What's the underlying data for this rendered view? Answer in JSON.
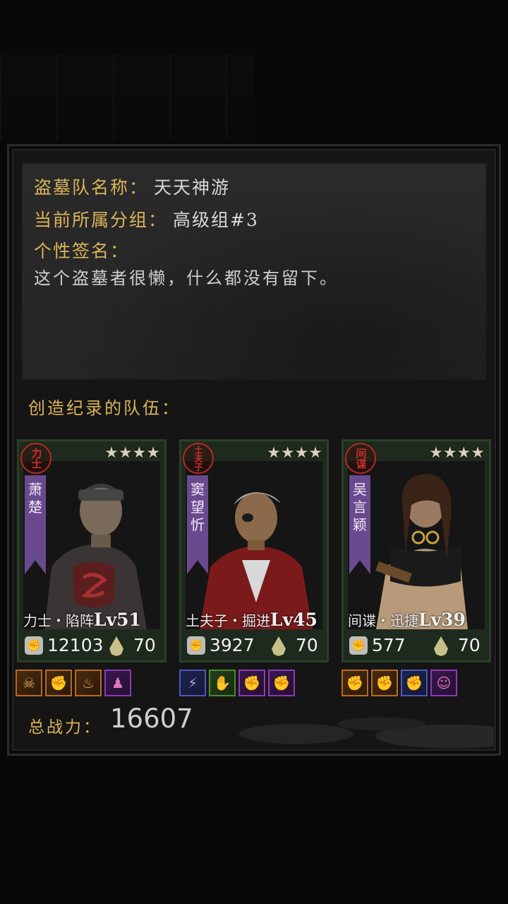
{
  "team": {
    "name_label": "盗墓队名称：",
    "name_value": "天天神游",
    "group_label": "当前所属分组：",
    "group_value": "高级组#3",
    "signature_label": "个性签名：",
    "signature_value": "这个盗墓者很懒，什么都没有留下。"
  },
  "record_title": "创造纪录的队伍：",
  "cards": [
    {
      "seal": "力士",
      "stars": "★★★★",
      "name_ribbon": [
        "萧",
        "楚"
      ],
      "class_text": "力士・陷阵",
      "level": "Lv51",
      "power": "12103",
      "energy": "70",
      "skills": [
        {
          "icon": "ghoul-skill-icon",
          "glyph": "☠",
          "tier": "orange"
        },
        {
          "icon": "fist-skill-icon",
          "glyph": "✊",
          "tier": "orange"
        },
        {
          "icon": "fire-skill-icon",
          "glyph": "♨",
          "tier": "orange"
        },
        {
          "icon": "shadow-skill-icon",
          "glyph": "♟",
          "tier": "purple"
        }
      ]
    },
    {
      "seal": "土夫子",
      "stars": "★★★★",
      "name_ribbon": [
        "窦",
        "望",
        "忻"
      ],
      "class_text": "土夫子・掘进",
      "level": "Lv45",
      "power": "3927",
      "energy": "70",
      "skills": [
        {
          "icon": "lightning-skill-icon",
          "glyph": "⚡",
          "tier": "blue"
        },
        {
          "icon": "claw-skill-icon",
          "glyph": "✋",
          "tier": "green"
        },
        {
          "icon": "purple-fist-skill-icon",
          "glyph": "✊",
          "tier": "purple"
        },
        {
          "icon": "green-fist-skill-icon",
          "glyph": "✊",
          "tier": "purple"
        }
      ]
    },
    {
      "seal": "间谍",
      "stars": "★★★★",
      "name_ribbon": [
        "吴",
        "言",
        "颖"
      ],
      "class_text": "间谍・迅捷",
      "level": "Lv39",
      "power": "577",
      "energy": "70",
      "skills": [
        {
          "icon": "orange-fist-skill-icon",
          "glyph": "✊",
          "tier": "orange"
        },
        {
          "icon": "hand-skill-icon",
          "glyph": "✊",
          "tier": "orange"
        },
        {
          "icon": "magenta-fist-skill-icon",
          "glyph": "✊",
          "tier": "blue"
        },
        {
          "icon": "portrait-skill-icon",
          "glyph": "☺",
          "tier": "purple"
        }
      ]
    }
  ],
  "total_label": "总战力：",
  "total_value": "16607",
  "colors": {
    "gold_text": "#dcb45a",
    "ribbon_purple": "#6a4a8e",
    "seal_red": "#c8302a",
    "card_border": "#2c3e29"
  }
}
